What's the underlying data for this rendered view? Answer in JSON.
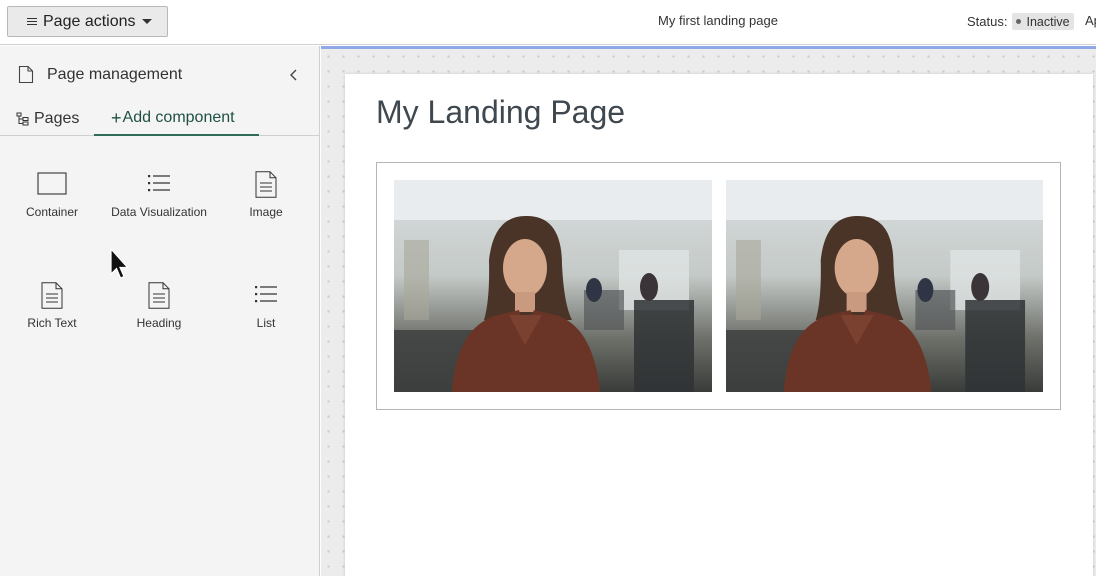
{
  "topbar": {
    "page_actions_label": "Page actions",
    "page_name": "My first landing page",
    "status_label": "Status:",
    "status_value": "Inactive",
    "cutoff_text": "Ap"
  },
  "sidebar": {
    "title": "Page management",
    "tabs": [
      {
        "label": "Pages"
      },
      {
        "label": "Add component"
      }
    ],
    "components": [
      {
        "label": "Container",
        "icon": "container-icon"
      },
      {
        "label": "Data Visualization",
        "icon": "list-icon"
      },
      {
        "label": "Image",
        "icon": "document-icon"
      },
      {
        "label": "Rich Text",
        "icon": "document-icon"
      },
      {
        "label": "Heading",
        "icon": "document-icon"
      },
      {
        "label": "List",
        "icon": "list-icon"
      }
    ]
  },
  "canvas": {
    "heading": "My Landing Page"
  },
  "colors": {
    "accent_tab": "#2e6b59",
    "canvas_top_border": "#8fa8e8",
    "status_badge_bg": "#e4e4e4"
  }
}
